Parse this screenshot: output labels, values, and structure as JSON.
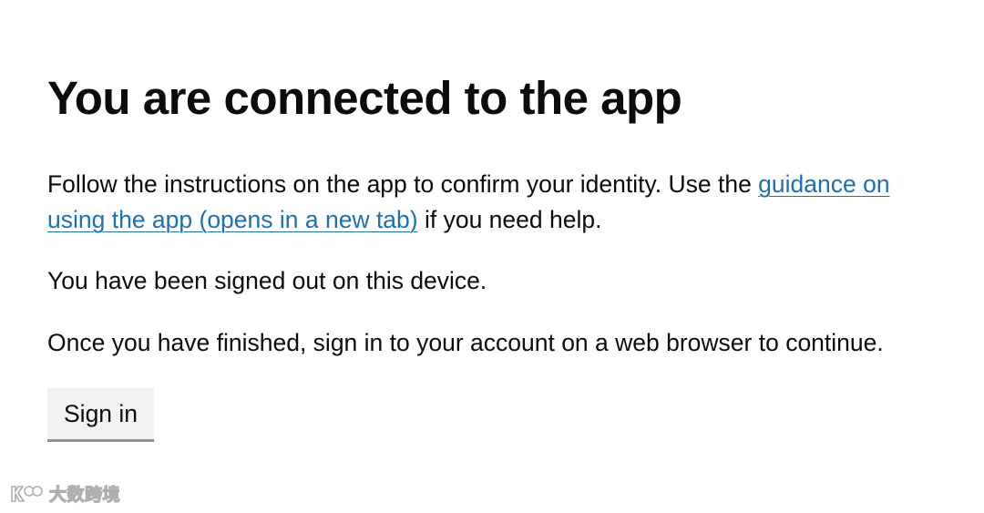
{
  "main": {
    "title": "You are connected to the app",
    "intro_text": "Follow the instructions on the app to confirm your identity. Use the ",
    "guidance_link": "guidance on using the app (opens in a new tab)",
    "intro_suffix": " if you need help.",
    "signed_out_text": "You have been signed out on this device.",
    "finished_text": "Once you have finished, sign in to your account on a web browser to continue.",
    "sign_in_label": "Sign in"
  },
  "watermark": {
    "text": "大数跨境"
  },
  "colors": {
    "link": "#1d70b8",
    "text": "#0b0c0c",
    "button_background": "#f3f2f1",
    "button_shadow": "#929191"
  }
}
